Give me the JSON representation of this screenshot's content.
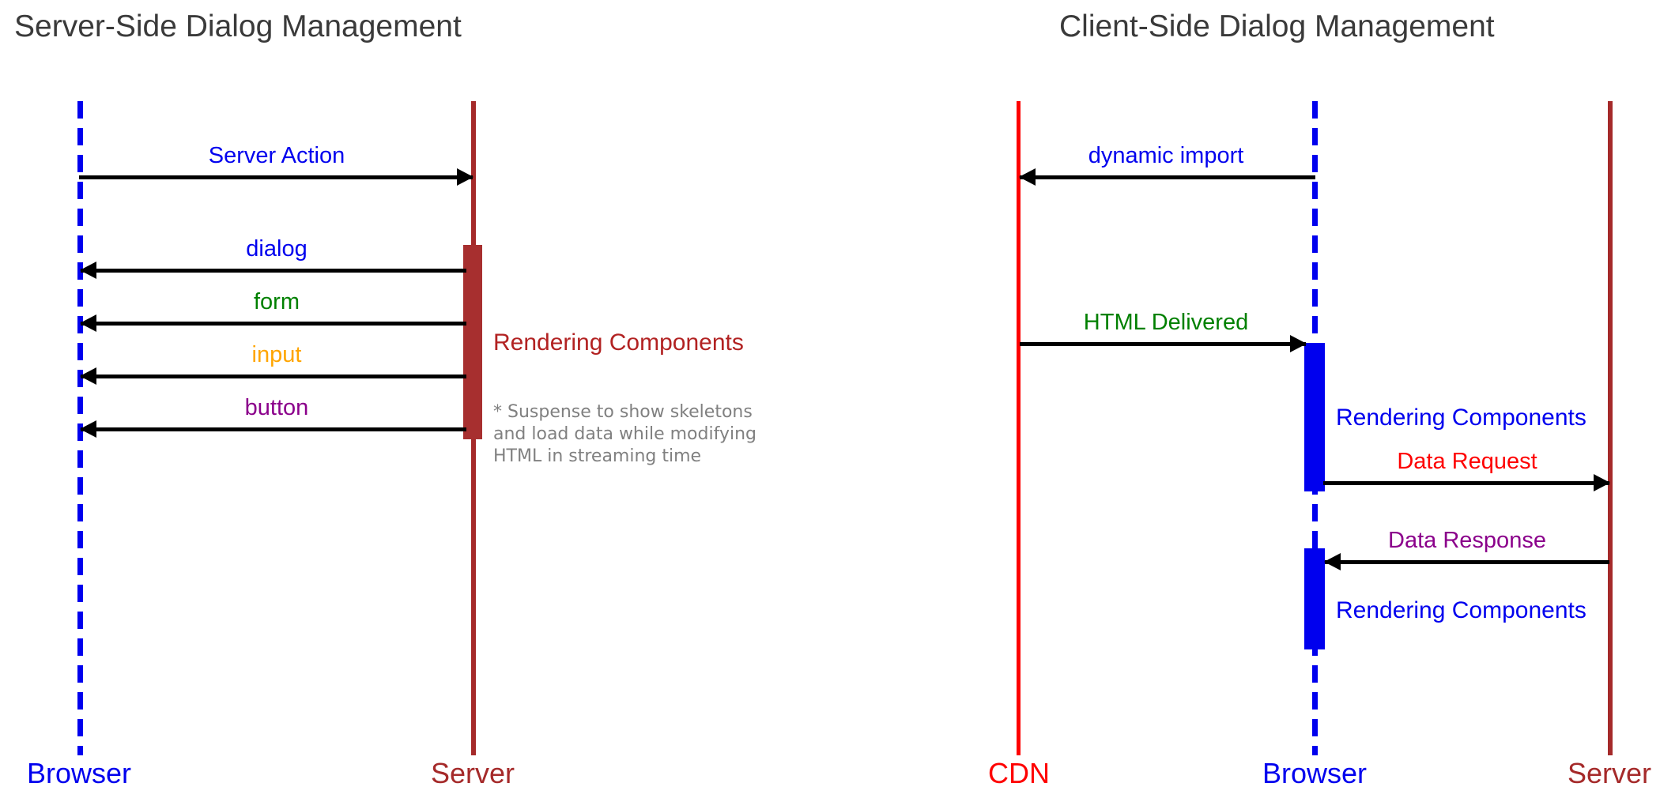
{
  "diagram": {
    "type": "sequence-diagram",
    "panels": [
      {
        "id": "server-side",
        "title": "Server-Side Dialog Management",
        "actors": [
          {
            "name": "Browser",
            "color": "#0000ee",
            "line_style": "dashed"
          },
          {
            "name": "Server",
            "color": "#a52a2a",
            "line_style": "solid"
          }
        ],
        "messages": [
          {
            "label": "Server Action",
            "color": "#0000ee",
            "from": "Browser",
            "to": "Server",
            "direction": "right"
          },
          {
            "label": "dialog",
            "color": "#0000ee",
            "from": "Server",
            "to": "Browser",
            "direction": "left"
          },
          {
            "label": "form",
            "color": "#008000",
            "from": "Server",
            "to": "Browser",
            "direction": "left"
          },
          {
            "label": "input",
            "color": "#ffa500",
            "from": "Server",
            "to": "Browser",
            "direction": "left"
          },
          {
            "label": "button",
            "color": "#8b008b",
            "from": "Server",
            "to": "Browser",
            "direction": "left"
          }
        ],
        "annotations": [
          {
            "text": "Rendering Components",
            "color": "#b22222"
          }
        ],
        "notes": [
          {
            "text": "* Suspense to show skeletons and load data while modifying HTML in streaming time",
            "color": "#808080"
          }
        ]
      },
      {
        "id": "client-side",
        "title": "Client-Side Dialog Management",
        "actors": [
          {
            "name": "CDN",
            "color": "#fe0000",
            "line_style": "solid"
          },
          {
            "name": "Browser",
            "color": "#0000ee",
            "line_style": "dashed"
          },
          {
            "name": "Server",
            "color": "#a52a2a",
            "line_style": "solid"
          }
        ],
        "messages": [
          {
            "label": "dynamic import",
            "color": "#0000ee",
            "from": "Browser",
            "to": "CDN",
            "direction": "left"
          },
          {
            "label": "HTML Delivered",
            "color": "#008000",
            "from": "CDN",
            "to": "Browser",
            "direction": "right"
          },
          {
            "label": "Data Request",
            "color": "#fe0000",
            "from": "Browser",
            "to": "Server",
            "direction": "right"
          },
          {
            "label": "Data Response",
            "color": "#8b008b",
            "from": "Server",
            "to": "Browser",
            "direction": "left"
          }
        ],
        "annotations": [
          {
            "text": "Rendering Components",
            "color": "#0000ee"
          },
          {
            "text": "Rendering Components",
            "color": "#0000ee"
          }
        ],
        "notes": []
      }
    ]
  },
  "colors": {
    "blue": "#0000ee",
    "green": "#008000",
    "orange": "#ffa500",
    "purple": "#8b008b",
    "bright_red": "#fe0000",
    "dark_red": "#a52a2a",
    "crimson": "#b22222",
    "gray": "#808080",
    "title_gray": "#3a3a3a",
    "arrow_black": "#000000"
  }
}
